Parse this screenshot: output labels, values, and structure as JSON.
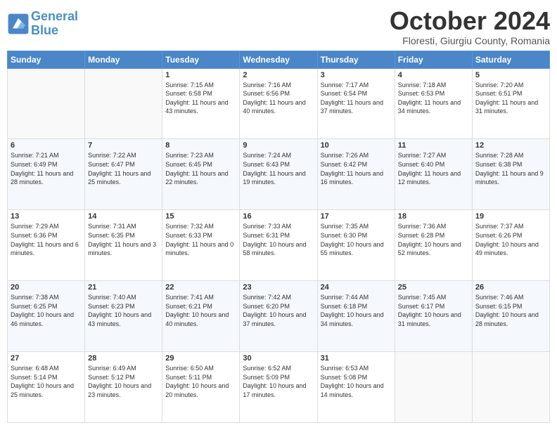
{
  "header": {
    "logo_line1": "General",
    "logo_line2": "Blue",
    "month": "October 2024",
    "location": "Floresti, Giurgiu County, Romania"
  },
  "days_of_week": [
    "Sunday",
    "Monday",
    "Tuesday",
    "Wednesday",
    "Thursday",
    "Friday",
    "Saturday"
  ],
  "weeks": [
    [
      {
        "day": "",
        "content": ""
      },
      {
        "day": "",
        "content": ""
      },
      {
        "day": "1",
        "content": "Sunrise: 7:15 AM\nSunset: 6:58 PM\nDaylight: 11 hours and 43 minutes."
      },
      {
        "day": "2",
        "content": "Sunrise: 7:16 AM\nSunset: 6:56 PM\nDaylight: 11 hours and 40 minutes."
      },
      {
        "day": "3",
        "content": "Sunrise: 7:17 AM\nSunset: 6:54 PM\nDaylight: 11 hours and 37 minutes."
      },
      {
        "day": "4",
        "content": "Sunrise: 7:18 AM\nSunset: 6:53 PM\nDaylight: 11 hours and 34 minutes."
      },
      {
        "day": "5",
        "content": "Sunrise: 7:20 AM\nSunset: 6:51 PM\nDaylight: 11 hours and 31 minutes."
      }
    ],
    [
      {
        "day": "6",
        "content": "Sunrise: 7:21 AM\nSunset: 6:49 PM\nDaylight: 11 hours and 28 minutes."
      },
      {
        "day": "7",
        "content": "Sunrise: 7:22 AM\nSunset: 6:47 PM\nDaylight: 11 hours and 25 minutes."
      },
      {
        "day": "8",
        "content": "Sunrise: 7:23 AM\nSunset: 6:45 PM\nDaylight: 11 hours and 22 minutes."
      },
      {
        "day": "9",
        "content": "Sunrise: 7:24 AM\nSunset: 6:43 PM\nDaylight: 11 hours and 19 minutes."
      },
      {
        "day": "10",
        "content": "Sunrise: 7:26 AM\nSunset: 6:42 PM\nDaylight: 11 hours and 16 minutes."
      },
      {
        "day": "11",
        "content": "Sunrise: 7:27 AM\nSunset: 6:40 PM\nDaylight: 11 hours and 12 minutes."
      },
      {
        "day": "12",
        "content": "Sunrise: 7:28 AM\nSunset: 6:38 PM\nDaylight: 11 hours and 9 minutes."
      }
    ],
    [
      {
        "day": "13",
        "content": "Sunrise: 7:29 AM\nSunset: 6:36 PM\nDaylight: 11 hours and 6 minutes."
      },
      {
        "day": "14",
        "content": "Sunrise: 7:31 AM\nSunset: 6:35 PM\nDaylight: 11 hours and 3 minutes."
      },
      {
        "day": "15",
        "content": "Sunrise: 7:32 AM\nSunset: 6:33 PM\nDaylight: 11 hours and 0 minutes."
      },
      {
        "day": "16",
        "content": "Sunrise: 7:33 AM\nSunset: 6:31 PM\nDaylight: 10 hours and 58 minutes."
      },
      {
        "day": "17",
        "content": "Sunrise: 7:35 AM\nSunset: 6:30 PM\nDaylight: 10 hours and 55 minutes."
      },
      {
        "day": "18",
        "content": "Sunrise: 7:36 AM\nSunset: 6:28 PM\nDaylight: 10 hours and 52 minutes."
      },
      {
        "day": "19",
        "content": "Sunrise: 7:37 AM\nSunset: 6:26 PM\nDaylight: 10 hours and 49 minutes."
      }
    ],
    [
      {
        "day": "20",
        "content": "Sunrise: 7:38 AM\nSunset: 6:25 PM\nDaylight: 10 hours and 46 minutes."
      },
      {
        "day": "21",
        "content": "Sunrise: 7:40 AM\nSunset: 6:23 PM\nDaylight: 10 hours and 43 minutes."
      },
      {
        "day": "22",
        "content": "Sunrise: 7:41 AM\nSunset: 6:21 PM\nDaylight: 10 hours and 40 minutes."
      },
      {
        "day": "23",
        "content": "Sunrise: 7:42 AM\nSunset: 6:20 PM\nDaylight: 10 hours and 37 minutes."
      },
      {
        "day": "24",
        "content": "Sunrise: 7:44 AM\nSunset: 6:18 PM\nDaylight: 10 hours and 34 minutes."
      },
      {
        "day": "25",
        "content": "Sunrise: 7:45 AM\nSunset: 6:17 PM\nDaylight: 10 hours and 31 minutes."
      },
      {
        "day": "26",
        "content": "Sunrise: 7:46 AM\nSunset: 6:15 PM\nDaylight: 10 hours and 28 minutes."
      }
    ],
    [
      {
        "day": "27",
        "content": "Sunrise: 6:48 AM\nSunset: 5:14 PM\nDaylight: 10 hours and 25 minutes."
      },
      {
        "day": "28",
        "content": "Sunrise: 6:49 AM\nSunset: 5:12 PM\nDaylight: 10 hours and 23 minutes."
      },
      {
        "day": "29",
        "content": "Sunrise: 6:50 AM\nSunset: 5:11 PM\nDaylight: 10 hours and 20 minutes."
      },
      {
        "day": "30",
        "content": "Sunrise: 6:52 AM\nSunset: 5:09 PM\nDaylight: 10 hours and 17 minutes."
      },
      {
        "day": "31",
        "content": "Sunrise: 6:53 AM\nSunset: 5:08 PM\nDaylight: 10 hours and 14 minutes."
      },
      {
        "day": "",
        "content": ""
      },
      {
        "day": "",
        "content": ""
      }
    ]
  ]
}
